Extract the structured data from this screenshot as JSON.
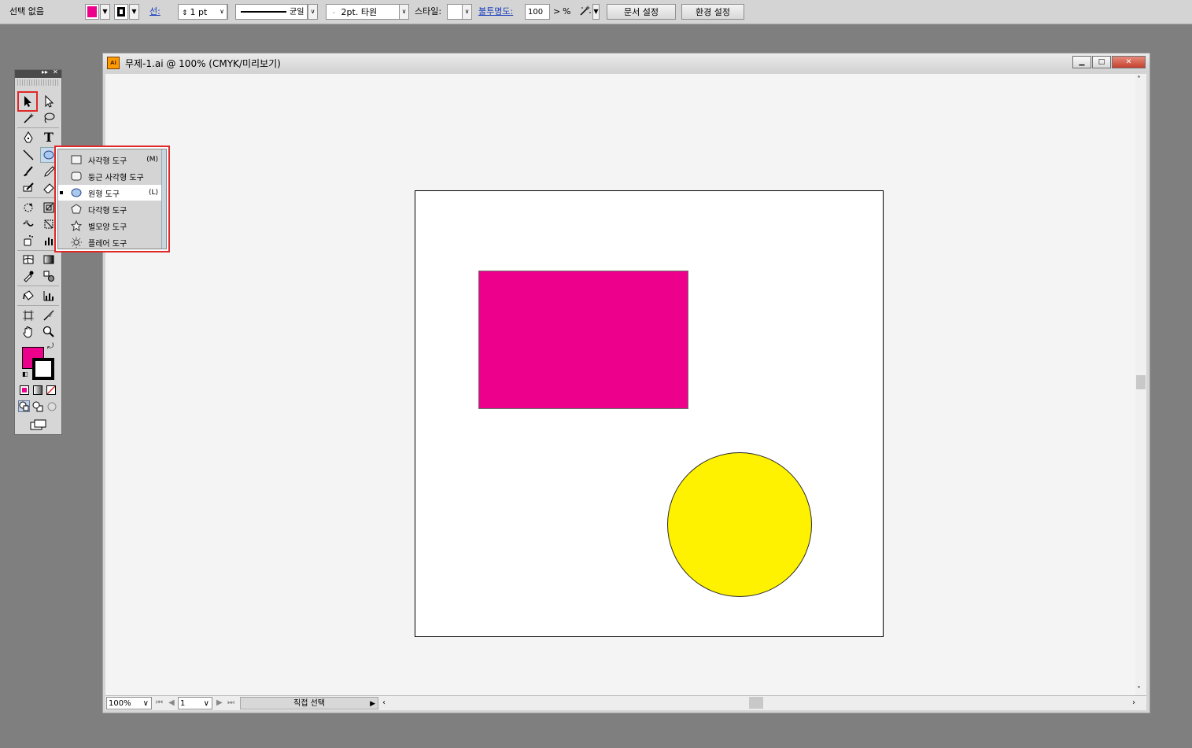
{
  "control_bar": {
    "selection_label": "선택 없음",
    "stroke_link": "선:",
    "stroke_weight": "1 pt",
    "profile_label": "균일",
    "brush_label": "2pt. 타원",
    "style_label": "스타일:",
    "opacity_link": "불투명도:",
    "opacity_value": "100",
    "opacity_more": ">",
    "percent": "%",
    "doc_setup_button": "문서 설정",
    "preferences_button": "환경 설정"
  },
  "colors": {
    "fill": "#ec008c",
    "rect_fill": "#ec008c",
    "circle_fill": "#fff200",
    "highlight": "#e02828"
  },
  "flyout": {
    "items": [
      {
        "label": "사각형 도구",
        "shortcut": "(M)",
        "icon": "rectangle-icon"
      },
      {
        "label": "둥근 사각형 도구",
        "shortcut": "",
        "icon": "rounded-rectangle-icon"
      },
      {
        "label": "원형 도구",
        "shortcut": "(L)",
        "icon": "ellipse-icon"
      },
      {
        "label": "다각형 도구",
        "shortcut": "",
        "icon": "polygon-icon"
      },
      {
        "label": "별모양 도구",
        "shortcut": "",
        "icon": "star-icon"
      },
      {
        "label": "플레어 도구",
        "shortcut": "",
        "icon": "flare-icon"
      }
    ]
  },
  "document": {
    "title": "무제-1.ai @ 100% (CMYK/미리보기)",
    "minimize": "▁",
    "maximize": "□",
    "close": "✕"
  },
  "status": {
    "zoom": "100%",
    "page": "1",
    "tool_label": "직접 선택"
  },
  "tools": {
    "type_glyph": "T"
  }
}
